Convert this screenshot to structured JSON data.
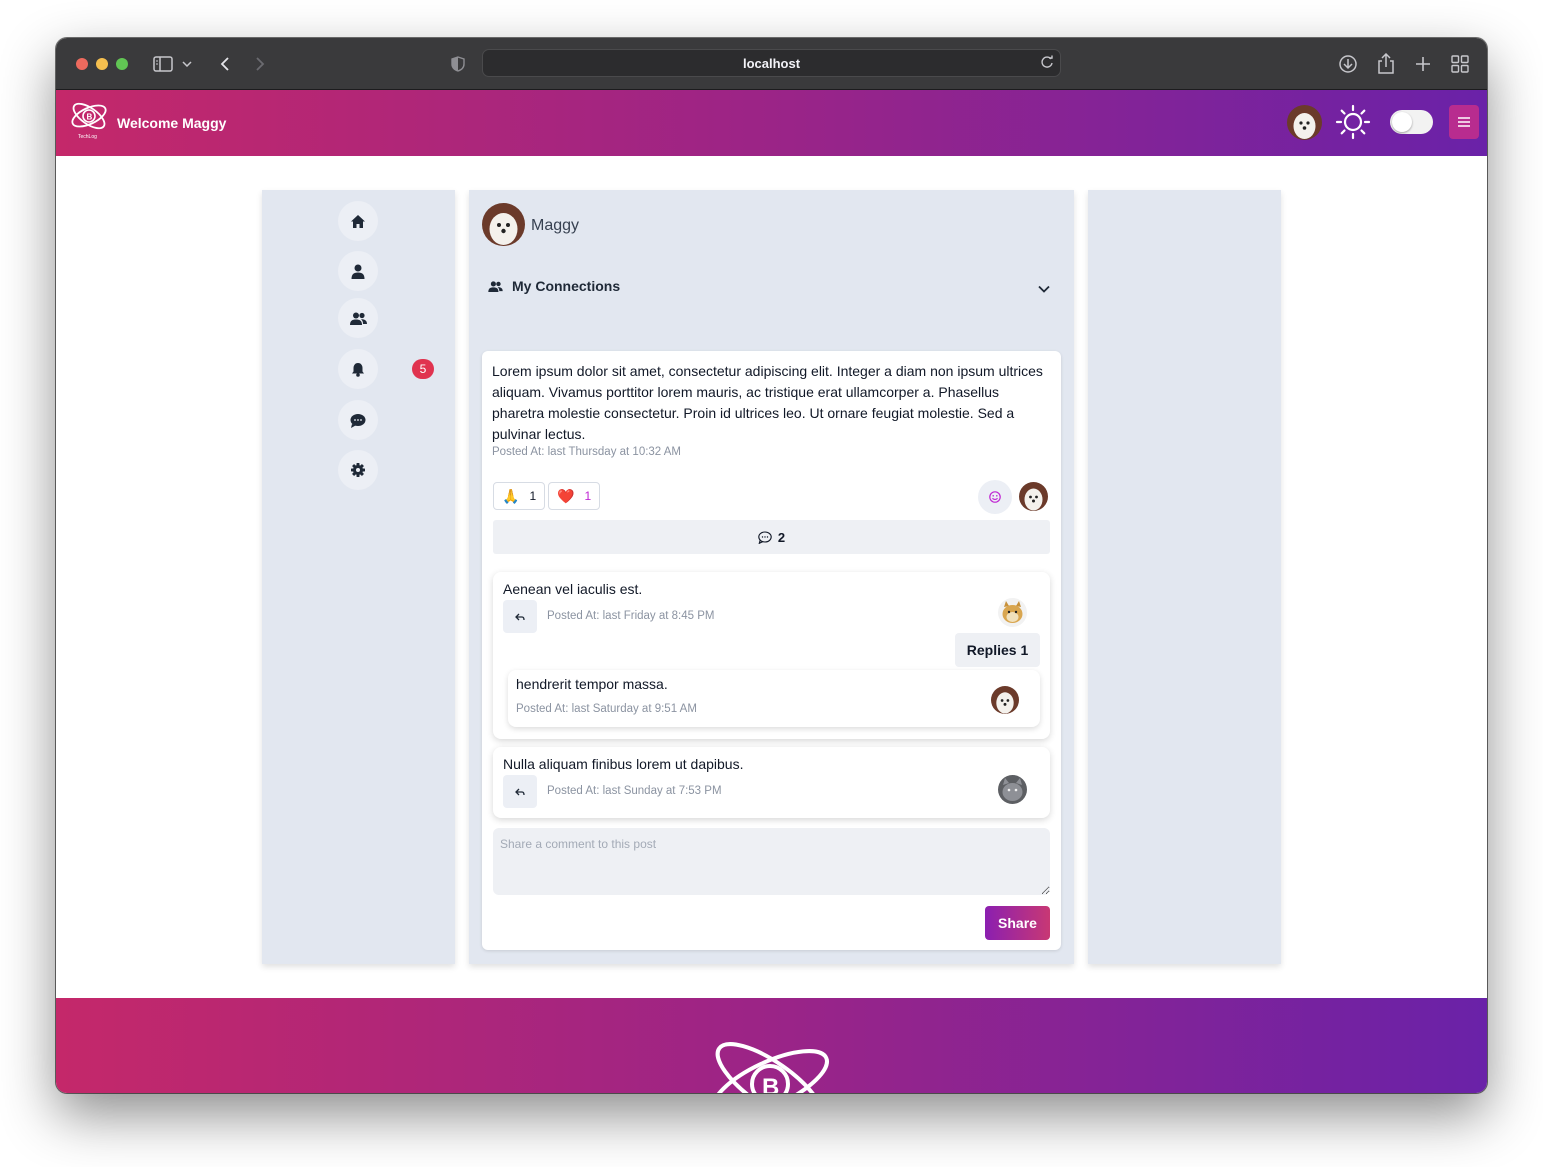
{
  "browser": {
    "url": "localhost"
  },
  "header": {
    "welcome_text": "Welcome Maggy",
    "logo_caption": "TechLog",
    "gradient_colors": [
      "#c4286a",
      "#9b2487",
      "#6a22a8"
    ],
    "menu_icon": "hamburger-icon",
    "theme_icon": "sun-icon"
  },
  "sidebar": {
    "items": [
      {
        "name": "home",
        "icon": "home-icon"
      },
      {
        "name": "profile",
        "icon": "user-icon"
      },
      {
        "name": "connections",
        "icon": "users-icon"
      },
      {
        "name": "notifications",
        "icon": "bell-icon",
        "badge": "5"
      },
      {
        "name": "messages",
        "icon": "chat-icon"
      },
      {
        "name": "settings",
        "icon": "gear-icon"
      }
    ]
  },
  "profile": {
    "name": "Maggy"
  },
  "connections": {
    "label": "My Connections"
  },
  "post": {
    "text": "Lorem ipsum dolor sit amet, consectetur adipiscing elit. Integer a diam non ipsum ultrices aliquam. Vivamus porttitor lorem mauris, ac tristique erat ullamcorper a. Phasellus pharetra molestie consectetur. Proin id ultrices leo. Ut ornare feugiat molestie. Sed a pulvinar lectus.",
    "posted_at": "Posted At: last Thursday at 10:32 AM",
    "reactions": [
      {
        "emoji": "🙏",
        "count": "1",
        "color": "#111827"
      },
      {
        "emoji": "❤️",
        "count": "1",
        "color": "#c026d3"
      }
    ],
    "comment_count": "2"
  },
  "comments": [
    {
      "text": "Aenean vel iaculis est.",
      "posted_at": "Posted At: last Friday at 8:45 PM",
      "replies_label": "Replies 1",
      "replies": [
        {
          "text": "hendrerit tempor massa.",
          "posted_at": "Posted At: last Saturday at 9:51 AM"
        }
      ]
    },
    {
      "text": "Nulla aliquam finibus lorem ut dapibus.",
      "posted_at": "Posted At: last Sunday at 7:53 PM"
    }
  ],
  "share": {
    "placeholder": "Share a comment to this post",
    "button_label": "Share"
  }
}
